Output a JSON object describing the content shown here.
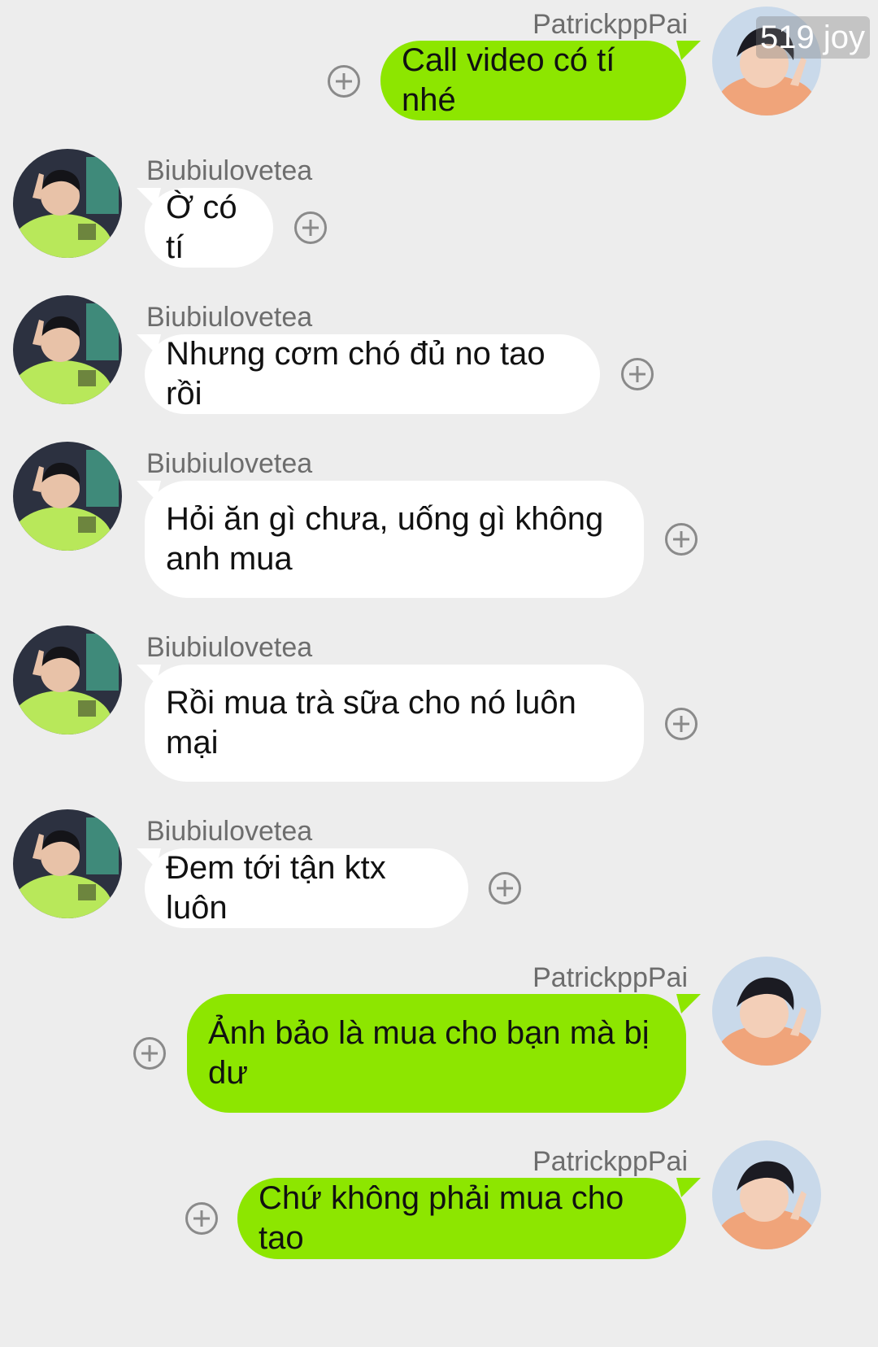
{
  "watermark": "519 joy",
  "colors": {
    "outgoing_bubble": "#8de600",
    "incoming_bubble": "#ffffff",
    "background": "#ededed"
  },
  "messages": [
    {
      "sender": "PatrickppPai",
      "direction": "out",
      "text": "Call video có tí nhé"
    },
    {
      "sender": "Biubiulovetea",
      "direction": "in",
      "text": "Ờ có tí"
    },
    {
      "sender": "Biubiulovetea",
      "direction": "in",
      "text": "Nhưng cơm chó đủ no tao rồi"
    },
    {
      "sender": "Biubiulovetea",
      "direction": "in",
      "text": "Hỏi ăn gì chưa, uống gì không anh mua"
    },
    {
      "sender": "Biubiulovetea",
      "direction": "in",
      "text": "Rồi mua trà sữa cho nó luôn mại"
    },
    {
      "sender": "Biubiulovetea",
      "direction": "in",
      "text": "Đem tới tận ktx luôn"
    },
    {
      "sender": "PatrickppPai",
      "direction": "out",
      "text": "Ảnh bảo là mua cho bạn mà bị dư"
    },
    {
      "sender": "PatrickppPai",
      "direction": "out",
      "text": "Chứ không phải mua cho tao"
    }
  ],
  "icons": {
    "reaction": "add-reaction-icon",
    "avatar_out": "user-avatar",
    "avatar_in": "contact-avatar"
  }
}
